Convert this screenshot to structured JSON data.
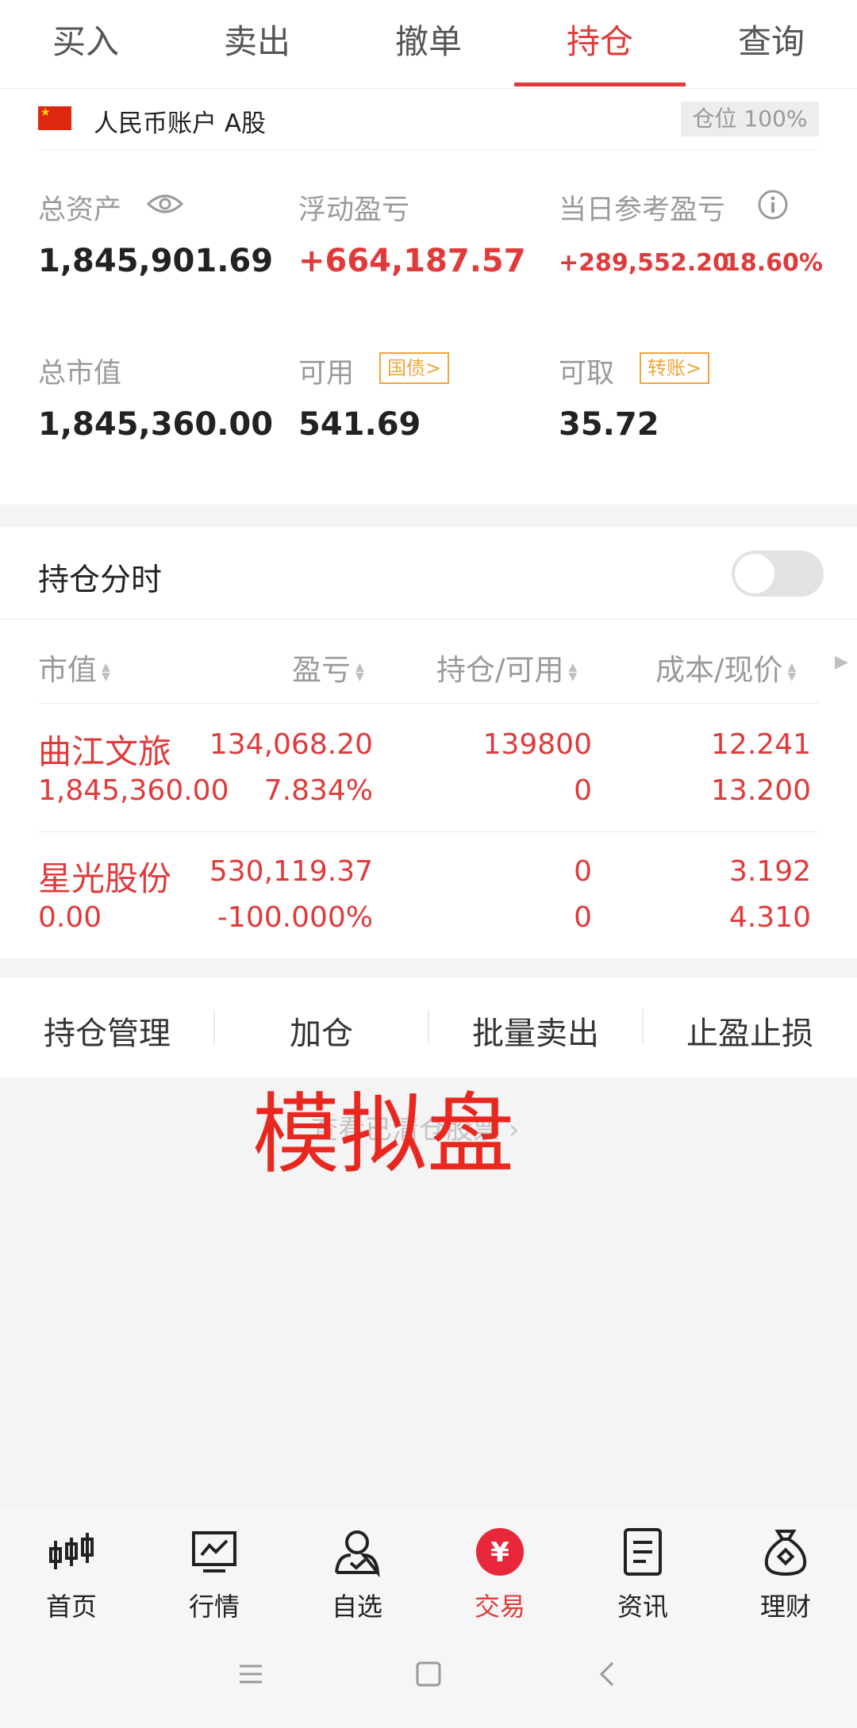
{
  "tabs": [
    "买入",
    "卖出",
    "撤单",
    "持仓",
    "查询"
  ],
  "account": {
    "name": "人民币账户 A股",
    "position_badge": "仓位 100%"
  },
  "summary": {
    "total_assets_label": "总资产",
    "total_assets_value": "1,845,901.69",
    "floating_pl_label": "浮动盈亏",
    "floating_pl_value": "+664,187.57",
    "daily_pl_label": "当日参考盈亏",
    "daily_pl_value": "+289,552.20",
    "daily_pl_pct": "18.60%",
    "market_value_label": "总市值",
    "market_value_value": "1,845,360.00",
    "available_label": "可用",
    "available_tag": "国债>",
    "available_value": "541.69",
    "withdrawable_label": "可取",
    "withdrawable_tag": "转账>",
    "withdrawable_value": "35.72"
  },
  "chart_toggle_label": "持仓分时",
  "table": {
    "headers": [
      "市值",
      "盈亏",
      "持仓/可用",
      "成本/现价"
    ],
    "rows": [
      {
        "name": "曲江文旅",
        "market_value": "1,845,360.00",
        "pl": "134,068.20",
        "pl_pct": "7.834%",
        "holding": "139800",
        "available": "0",
        "cost": "12.241",
        "price": "13.200"
      },
      {
        "name": "星光股份",
        "market_value": "0.00",
        "pl": "530,119.37",
        "pl_pct": "-100.000%",
        "holding": "0",
        "available": "0",
        "cost": "3.192",
        "price": "4.310"
      }
    ]
  },
  "actions": [
    "持仓管理",
    "加仓",
    "批量卖出",
    "止盈止损"
  ],
  "cleared_link": "查看已清仓股票",
  "watermark": "模拟盘",
  "nav": [
    {
      "label": "首页",
      "icon": "candlestick-icon"
    },
    {
      "label": "行情",
      "icon": "trend-chart-icon"
    },
    {
      "label": "自选",
      "icon": "user-check-icon"
    },
    {
      "label": "交易",
      "icon": "yuan-coin-icon"
    },
    {
      "label": "资讯",
      "icon": "document-icon"
    },
    {
      "label": "理财",
      "icon": "money-bag-icon"
    }
  ],
  "colors": {
    "accent": "#e23b3b",
    "tag": "#f0a53a"
  }
}
